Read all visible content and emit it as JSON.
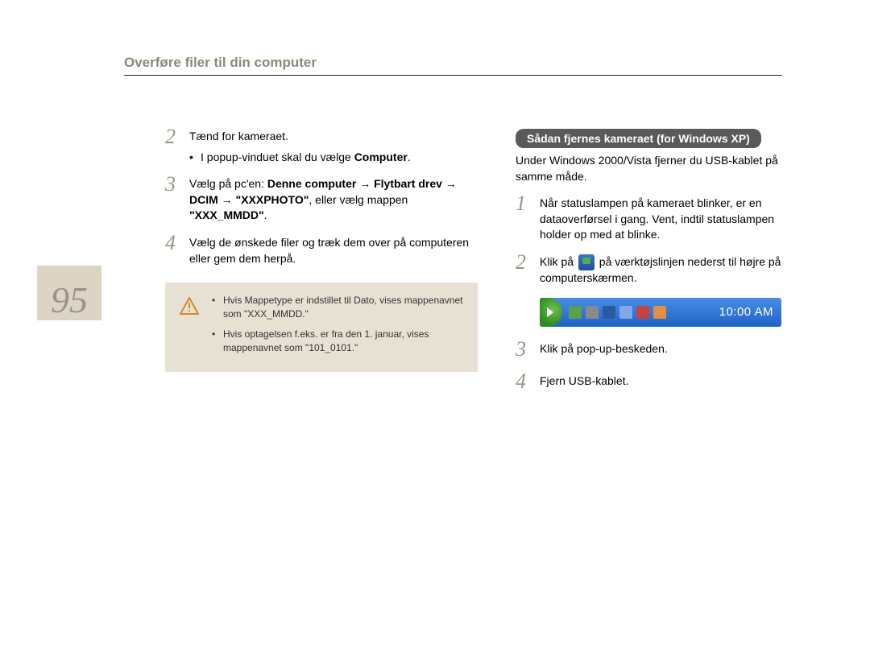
{
  "header": {
    "title": "Overføre filer til din computer"
  },
  "page_number": "95",
  "left": {
    "step2": {
      "num": "2",
      "text": "Tænd for kameraet.",
      "bullet_prefix": "I popup-vinduet skal du vælge ",
      "bullet_bold": "Computer",
      "bullet_suffix": "."
    },
    "step3": {
      "num": "3",
      "prefix": "Vælg på pc'en: ",
      "bold": "Denne computer → Flytbart drev → DCIM → \"XXXPHOTO\"",
      "middle": ", eller vælg mappen ",
      "bold2": "\"XXX_MMDD\"",
      "suffix": "."
    },
    "step4": {
      "num": "4",
      "text": "Vælg de ønskede filer og træk dem over på computeren eller gem dem herpå."
    },
    "note": {
      "bullet1": "Hvis Mappetype er indstillet til Dato, vises mappenavnet som \"XXX_MMDD.\"",
      "bullet2": "Hvis optagelsen f.eks. er fra den 1. januar, vises mappenavnet som \"101_0101.\""
    }
  },
  "right": {
    "section_title": "Sådan fjernes kameraet (for Windows XP)",
    "intro": "Under Windows 2000/Vista fjerner du USB-kablet på samme måde.",
    "step1": {
      "num": "1",
      "text": "Når statuslampen på kameraet blinker, er en dataoverførsel i gang. Vent, indtil statuslampen holder op med at blinke."
    },
    "step2": {
      "num": "2",
      "before": "Klik på ",
      "after": " på værktøjslinjen nederst til højre på computerskærmen."
    },
    "taskbar_time": "10:00 AM",
    "step3": {
      "num": "3",
      "text": "Klik på pop-up-beskeden."
    },
    "step4": {
      "num": "4",
      "text": "Fjern USB-kablet."
    }
  }
}
